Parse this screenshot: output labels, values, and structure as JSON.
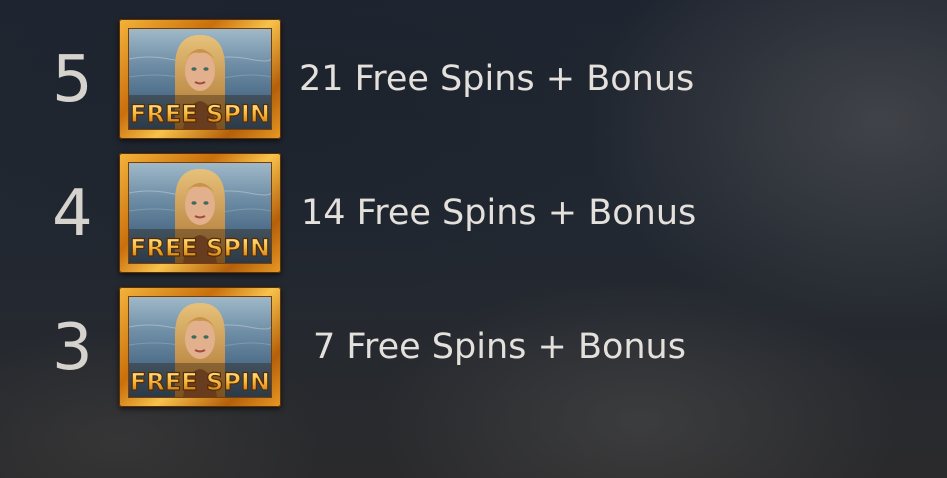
{
  "paytable": {
    "symbol_name": "Free Spin",
    "symbol_caption": "FREE SPIN",
    "rows": [
      {
        "count": "5",
        "prize": "21 Free Spins + Bonus"
      },
      {
        "count": "4",
        "prize": "14 Free Spins + Bonus"
      },
      {
        "count": "3",
        "prize": "7 Free Spins + Bonus"
      }
    ]
  },
  "colors": {
    "frame_gold": "#e9a22a",
    "caption_gold": "#f5b83a",
    "text": "#e4e1dc",
    "background": "#222831"
  }
}
